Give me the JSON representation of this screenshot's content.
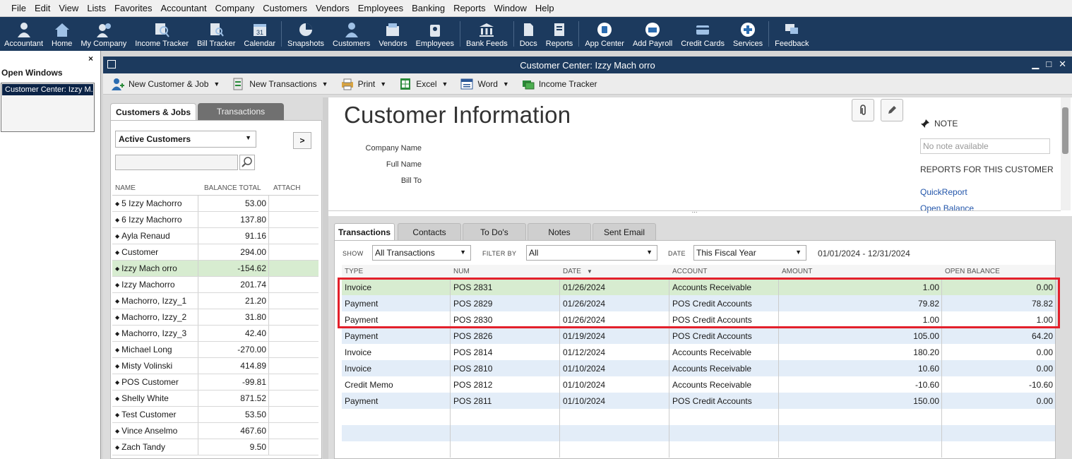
{
  "menu": [
    "File",
    "Edit",
    "View",
    "Lists",
    "Favorites",
    "Accountant",
    "Company",
    "Customers",
    "Vendors",
    "Employees",
    "Banking",
    "Reports",
    "Window",
    "Help"
  ],
  "toolbar": [
    {
      "label": "Accountant",
      "icon": "accountant-icon"
    },
    {
      "label": "Home",
      "icon": "home-icon"
    },
    {
      "label": "My Company",
      "icon": "my-company-icon"
    },
    {
      "label": "Income Tracker",
      "icon": "income-tracker-icon"
    },
    {
      "label": "Bill Tracker",
      "icon": "bill-tracker-icon"
    },
    {
      "label": "Calendar",
      "icon": "calendar-icon"
    },
    {
      "label": "Snapshots",
      "icon": "snapshots-icon"
    },
    {
      "label": "Customers",
      "icon": "customers-icon"
    },
    {
      "label": "Vendors",
      "icon": "vendors-icon"
    },
    {
      "label": "Employees",
      "icon": "employees-icon"
    },
    {
      "label": "Bank Feeds",
      "icon": "bank-feeds-icon"
    },
    {
      "label": "Docs",
      "icon": "docs-icon"
    },
    {
      "label": "Reports",
      "icon": "reports-icon"
    },
    {
      "label": "App Center",
      "icon": "app-center-icon"
    },
    {
      "label": "Add Payroll",
      "icon": "add-payroll-icon"
    },
    {
      "label": "Credit Cards",
      "icon": "credit-cards-icon"
    },
    {
      "label": "Services",
      "icon": "services-icon"
    },
    {
      "label": "Feedback",
      "icon": "feedback-icon"
    }
  ],
  "open_windows": {
    "title": "Open Windows",
    "items": [
      "Customer Center: Izzy M..."
    ]
  },
  "window": {
    "title": "Customer Center: Izzy Mach orro"
  },
  "actions": [
    {
      "label": "New Customer & Job",
      "icon": "new-customer-icon"
    },
    {
      "label": "New Transactions",
      "icon": "new-transactions-icon"
    },
    {
      "label": "Print",
      "icon": "print-icon"
    },
    {
      "label": "Excel",
      "icon": "excel-icon"
    },
    {
      "label": "Word",
      "icon": "word-icon"
    },
    {
      "label": "Income Tracker",
      "icon": "income-tracker-icon"
    }
  ],
  "left": {
    "tabs": [
      "Customers & Jobs",
      "Transactions"
    ],
    "filter": "Active Customers",
    "expand": ">",
    "columns": [
      "NAME",
      "BALANCE TOTAL",
      "ATTACH"
    ],
    "rows": [
      {
        "name": "5 Izzy Machorro",
        "balance": "53.00"
      },
      {
        "name": "6 Izzy Machorro",
        "balance": "137.80"
      },
      {
        "name": "Ayla Renaud",
        "balance": "91.16"
      },
      {
        "name": "Customer",
        "balance": "294.00"
      },
      {
        "name": "Izzy Mach orro",
        "balance": "-154.62",
        "selected": true
      },
      {
        "name": "Izzy Machorro",
        "balance": "201.74"
      },
      {
        "name": "Machorro, Izzy_1",
        "balance": "21.20"
      },
      {
        "name": "Machorro, Izzy_2",
        "balance": "31.80"
      },
      {
        "name": "Machorro, Izzy_3",
        "balance": "42.40"
      },
      {
        "name": "Michael Long",
        "balance": "-270.00"
      },
      {
        "name": "Misty Volinski",
        "balance": "414.89"
      },
      {
        "name": "POS Customer",
        "balance": "-99.81"
      },
      {
        "name": "Shelly White",
        "balance": "871.52"
      },
      {
        "name": "Test Customer",
        "balance": "53.50"
      },
      {
        "name": "Vince Anselmo",
        "balance": "467.60"
      },
      {
        "name": "Zach Tandy",
        "balance": "9.50"
      }
    ]
  },
  "info": {
    "title": "Customer Information",
    "labels": [
      "Company Name",
      "Full Name",
      "Bill To"
    ],
    "note_header": "NOTE",
    "note_placeholder": "No note available",
    "reports_header": "REPORTS FOR THIS CUSTOMER",
    "report_links": [
      "QuickReport",
      "Open Balance"
    ]
  },
  "tx": {
    "tabs": [
      "Transactions",
      "Contacts",
      "To Do's",
      "Notes",
      "Sent Email"
    ],
    "show_label": "SHOW",
    "show_value": "All Transactions",
    "filter_label": "FILTER BY",
    "filter_value": "All",
    "date_label": "DATE",
    "date_value": "This Fiscal Year",
    "date_range": "01/01/2024 - 12/31/2024",
    "columns": [
      "TYPE",
      "NUM",
      "DATE",
      "ACCOUNT",
      "AMOUNT",
      "OPEN BALANCE"
    ],
    "rows": [
      {
        "type": "Invoice",
        "num": "POS 2831",
        "date": "01/26/2024",
        "account": "Accounts Receivable",
        "amount": "1.00",
        "open": "0.00"
      },
      {
        "type": "Payment",
        "num": "POS 2829",
        "date": "01/26/2024",
        "account": "POS Credit Accounts",
        "amount": "79.82",
        "open": "78.82"
      },
      {
        "type": "Payment",
        "num": "POS 2830",
        "date": "01/26/2024",
        "account": "POS Credit Accounts",
        "amount": "1.00",
        "open": "1.00"
      },
      {
        "type": "Payment",
        "num": "POS 2826",
        "date": "01/19/2024",
        "account": "POS Credit Accounts",
        "amount": "105.00",
        "open": "64.20"
      },
      {
        "type": "Invoice",
        "num": "POS 2814",
        "date": "01/12/2024",
        "account": "Accounts Receivable",
        "amount": "180.20",
        "open": "0.00"
      },
      {
        "type": "Invoice",
        "num": "POS 2810",
        "date": "01/10/2024",
        "account": "Accounts Receivable",
        "amount": "10.60",
        "open": "0.00"
      },
      {
        "type": "Credit Memo",
        "num": "POS 2812",
        "date": "01/10/2024",
        "account": "Accounts Receivable",
        "amount": "-10.60",
        "open": "-10.60"
      },
      {
        "type": "Payment",
        "num": "POS 2811",
        "date": "01/10/2024",
        "account": "POS Credit Accounts",
        "amount": "150.00",
        "open": "0.00"
      }
    ]
  },
  "colors": {
    "navy": "#1c3a5e",
    "selected_row": "#d7ecd0",
    "alt_row": "#e3edf8",
    "highlight": "#e3202b",
    "link": "#2255aa"
  }
}
